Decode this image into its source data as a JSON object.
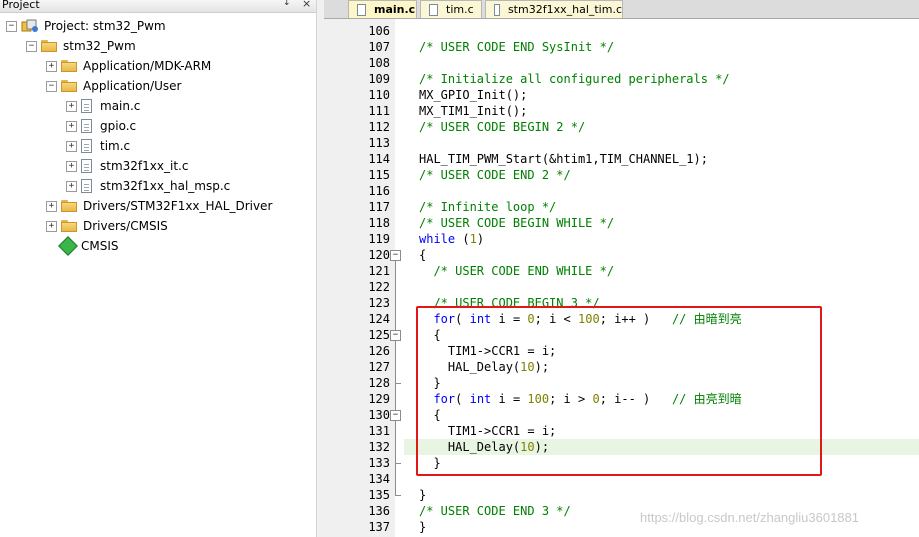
{
  "project_panel": {
    "title": "Project",
    "pin": "↓",
    "close": "×",
    "tree": [
      {
        "label": "Project: stm32_Pwm",
        "icon": "project-icon",
        "toggle": "−"
      },
      {
        "label": "stm32_Pwm",
        "icon": "target-icon",
        "toggle": "−"
      },
      {
        "label": "Application/MDK-ARM",
        "icon": "folder-icon",
        "toggle": "+"
      },
      {
        "label": "Application/User",
        "icon": "folder-icon",
        "toggle": "−"
      },
      {
        "label": "main.c",
        "icon": "file-icon",
        "toggle": "+"
      },
      {
        "label": "gpio.c",
        "icon": "file-icon",
        "toggle": "+"
      },
      {
        "label": "tim.c",
        "icon": "file-icon",
        "toggle": "+"
      },
      {
        "label": "stm32f1xx_it.c",
        "icon": "file-icon",
        "toggle": "+"
      },
      {
        "label": "stm32f1xx_hal_msp.c",
        "icon": "file-icon",
        "toggle": "+"
      },
      {
        "label": "Drivers/STM32F1xx_HAL_Driver",
        "icon": "folder-icon",
        "toggle": "+"
      },
      {
        "label": "Drivers/CMSIS",
        "icon": "folder-icon",
        "toggle": "+"
      },
      {
        "label": "CMSIS",
        "icon": "cmsis-gem-icon",
        "toggle": ""
      }
    ]
  },
  "tabs": [
    {
      "label": "main.c",
      "active": true
    },
    {
      "label": "tim.c",
      "active": false
    },
    {
      "label": "stm32f1xx_hal_tim.c",
      "active": false
    }
  ],
  "editor": {
    "lines": [
      {
        "n": "106",
        "code": [
          {
            "t": "",
            "c": ""
          }
        ]
      },
      {
        "n": "107",
        "code": [
          {
            "t": "/* USER CODE END SysInit */",
            "c": "cm"
          }
        ]
      },
      {
        "n": "108",
        "code": [
          {
            "t": "",
            "c": ""
          }
        ]
      },
      {
        "n": "109",
        "code": [
          {
            "t": "/* Initialize all configured peripherals */",
            "c": "cm"
          }
        ]
      },
      {
        "n": "110",
        "code": [
          {
            "t": "MX_GPIO_Init();",
            "c": ""
          }
        ]
      },
      {
        "n": "111",
        "code": [
          {
            "t": "MX_TIM1_Init();",
            "c": ""
          }
        ]
      },
      {
        "n": "112",
        "code": [
          {
            "t": "/* USER CODE BEGIN 2 */",
            "c": "cm"
          }
        ]
      },
      {
        "n": "113",
        "code": [
          {
            "t": "",
            "c": ""
          }
        ]
      },
      {
        "n": "114",
        "code": [
          {
            "t": "HAL_TIM_PWM_Start(&htim1,TIM_CHANNEL_1);",
            "c": ""
          }
        ]
      },
      {
        "n": "115",
        "code": [
          {
            "t": "/* USER CODE END 2 */",
            "c": "cm"
          }
        ]
      },
      {
        "n": "116",
        "code": [
          {
            "t": "",
            "c": ""
          }
        ]
      },
      {
        "n": "117",
        "code": [
          {
            "t": "/* Infinite loop */",
            "c": "cm"
          }
        ]
      },
      {
        "n": "118",
        "code": [
          {
            "t": "/* USER CODE BEGIN WHILE */",
            "c": "cm"
          }
        ]
      },
      {
        "n": "119",
        "code": [
          {
            "t": "while",
            "c": "kw"
          },
          {
            "t": " (",
            "c": ""
          },
          {
            "t": "1",
            "c": "nm"
          },
          {
            "t": ")",
            "c": ""
          }
        ]
      },
      {
        "n": "120",
        "code": [
          {
            "t": "{",
            "c": ""
          }
        ]
      },
      {
        "n": "121",
        "code": [
          {
            "t": "  /* USER CODE END WHILE */",
            "c": "cm"
          }
        ]
      },
      {
        "n": "122",
        "code": [
          {
            "t": "",
            "c": ""
          }
        ]
      },
      {
        "n": "123",
        "code": [
          {
            "t": "  /* USER CODE BEGIN 3 */",
            "c": "cm"
          }
        ]
      },
      {
        "n": "124",
        "code": [
          {
            "t": "  ",
            "c": ""
          },
          {
            "t": "for",
            "c": "kw"
          },
          {
            "t": "( ",
            "c": ""
          },
          {
            "t": "int",
            "c": "kw"
          },
          {
            "t": " i = ",
            "c": ""
          },
          {
            "t": "0",
            "c": "nm"
          },
          {
            "t": "; i < ",
            "c": ""
          },
          {
            "t": "100",
            "c": "nm"
          },
          {
            "t": "; i++ )   ",
            "c": ""
          },
          {
            "t": "// 由暗到亮",
            "c": "cm"
          }
        ]
      },
      {
        "n": "125",
        "code": [
          {
            "t": "  {",
            "c": ""
          }
        ]
      },
      {
        "n": "126",
        "code": [
          {
            "t": "    TIM1->CCR1 = i;",
            "c": ""
          }
        ]
      },
      {
        "n": "127",
        "code": [
          {
            "t": "    HAL_Delay(",
            "c": ""
          },
          {
            "t": "10",
            "c": "nm"
          },
          {
            "t": ");",
            "c": ""
          }
        ]
      },
      {
        "n": "128",
        "code": [
          {
            "t": "  }",
            "c": ""
          }
        ]
      },
      {
        "n": "129",
        "code": [
          {
            "t": "  ",
            "c": ""
          },
          {
            "t": "for",
            "c": "kw"
          },
          {
            "t": "( ",
            "c": ""
          },
          {
            "t": "int",
            "c": "kw"
          },
          {
            "t": " i = ",
            "c": ""
          },
          {
            "t": "100",
            "c": "nm"
          },
          {
            "t": "; i > ",
            "c": ""
          },
          {
            "t": "0",
            "c": "nm"
          },
          {
            "t": "; i-- )   ",
            "c": ""
          },
          {
            "t": "// 由亮到暗",
            "c": "cm"
          }
        ]
      },
      {
        "n": "130",
        "code": [
          {
            "t": "  {",
            "c": ""
          }
        ]
      },
      {
        "n": "131",
        "code": [
          {
            "t": "    TIM1->CCR1 = i;",
            "c": ""
          }
        ]
      },
      {
        "n": "132",
        "code": [
          {
            "t": "    HAL_Delay(",
            "c": ""
          },
          {
            "t": "10",
            "c": "nm"
          },
          {
            "t": ");",
            "c": ""
          }
        ]
      },
      {
        "n": "133",
        "code": [
          {
            "t": "  }",
            "c": ""
          }
        ]
      },
      {
        "n": "134",
        "code": [
          {
            "t": "",
            "c": ""
          }
        ]
      },
      {
        "n": "135",
        "code": [
          {
            "t": "}",
            "c": ""
          }
        ]
      },
      {
        "n": "136",
        "code": [
          {
            "t": "/* USER CODE END 3 */",
            "c": "cm"
          }
        ]
      },
      {
        "n": "137",
        "code": [
          {
            "t": "}",
            "c": ""
          }
        ]
      }
    ],
    "highlighted_line": "132",
    "watermark": "https://blog.csdn.net/zhangliu3601881"
  },
  "colors": {
    "comment": "#008000",
    "keyword": "#0000ff",
    "number": "#808000",
    "annotation_box": "#e01818",
    "current_line": "#e8f5e2"
  }
}
